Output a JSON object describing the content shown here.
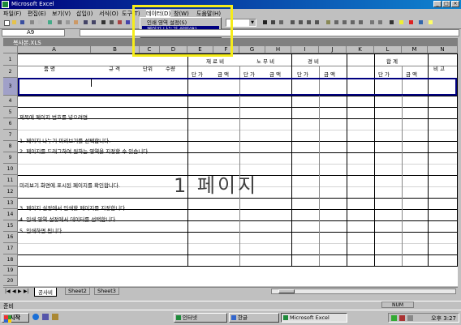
{
  "window": {
    "title": "Microsoft Excel",
    "min": "_",
    "max": "□",
    "close": "×"
  },
  "menubar": [
    "파일(F)",
    "편집(E)",
    "보기(V)",
    "삽입(I)",
    "서식(O)",
    "도구(T)",
    "데이터(D)",
    "창(W)",
    "도움말(H)"
  ],
  "context_menu": {
    "items": [
      "인쇄 영역 설정(S)",
      "페이지 나누기 삽입(B)"
    ],
    "selected_index": 1,
    "more": "»"
  },
  "namebox": {
    "value": "A9"
  },
  "workbook_title": "복사본.XLS",
  "columns": [
    "A",
    "B",
    "C",
    "D",
    "E",
    "F",
    "G",
    "H",
    "I",
    "J",
    "K",
    "L",
    "M",
    "N"
  ],
  "header_cells": {
    "r1": [
      "품 명",
      "규 격",
      "단위",
      "수량"
    ],
    "r1_groups": [
      "재 료 비",
      "노 무 비",
      "경 비",
      "합 계"
    ],
    "r1_note": "비 고",
    "r2": [
      "단 가",
      "금 액",
      "단 가",
      "금 액",
      "단 가",
      "금 액",
      "단 가",
      "금 액"
    ]
  },
  "rows": [
    "1",
    "2",
    "3",
    "4",
    "5",
    "6",
    "7",
    "8",
    "9",
    "10",
    "11",
    "12",
    "13",
    "14",
    "15",
    "16",
    "17",
    "18",
    "19",
    "20"
  ],
  "text_lines": [
    "제목에 페이지 번호를 넣으려면",
    "1. 페이지 나누기 미리보기를 선택합니다.",
    "2. 페이지를 드래그하여 원하는 영역을 지정할 수 있습니다.",
    "미리보기 화면에 표시된 페이지를 확인합니다.",
    "3. 페이지 설정에서 인쇄할 페이지를 지정합니다.",
    "4. 인쇄 영역 설정에서 데이터를 선택합니다.",
    "5. 인쇄하면 됩니다."
  ],
  "watermark": "1 페이지",
  "sheet_tabs": [
    "공사비",
    "Sheet2",
    "Sheet3"
  ],
  "status": {
    "left": "준비",
    "right": "NUM"
  },
  "taskbar": {
    "start": "시작",
    "items": [
      "인터넷",
      "한글",
      "Microsoft Excel"
    ],
    "clock": "오후 3:27"
  }
}
